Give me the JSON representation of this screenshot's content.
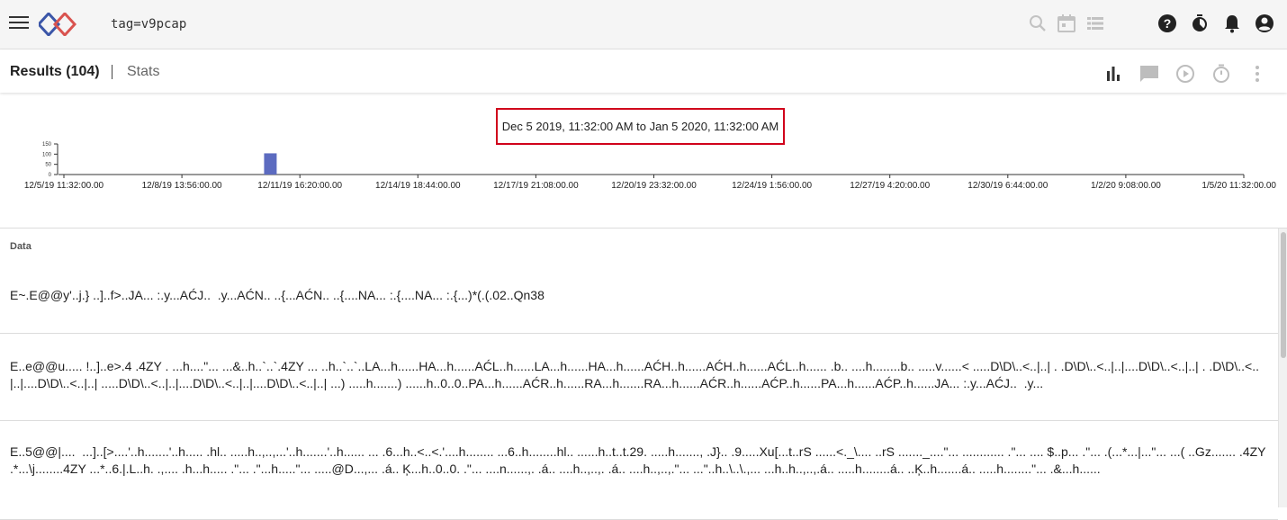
{
  "topbar": {
    "query": "tag=v9pcap",
    "icons": [
      "menu-icon",
      "gravwell-logo",
      "search-icon",
      "calendar-icon",
      "list-icon",
      "help-icon",
      "timer-icon",
      "notifications-icon",
      "account-icon"
    ]
  },
  "results_bar": {
    "results_label": "Results (104)",
    "stats_label": "Stats",
    "icons": [
      "bar-chart-icon",
      "comment-icon",
      "play-icon",
      "stopwatch-icon",
      "more-vert-icon"
    ]
  },
  "chart": {
    "time_range": "Dec 5 2019, 11:32:00 AM to Jan 5 2020, 11:32:00 AM",
    "colors": {
      "bar": "#5c6bc0",
      "range_border": "#d0021b"
    }
  },
  "chart_data": {
    "type": "bar",
    "x_ticks": [
      "12/5/19 11:32:00.00",
      "12/8/19 13:56:00.00",
      "12/11/19 16:20:00.00",
      "12/14/19 18:44:00.00",
      "12/17/19 21:08:00.00",
      "12/20/19 23:32:00.00",
      "12/24/19 1:56:00.00",
      "12/27/19 4:20:00.00",
      "12/30/19 6:44:00.00",
      "1/2/20 9:08:00.00",
      "1/5/20 11:32:00.00"
    ],
    "y_ticks": [
      "150",
      "100",
      "50",
      "0"
    ],
    "bars": [
      {
        "x_tick_index": 1.75,
        "value": 104
      }
    ],
    "ylim": [
      0,
      150
    ]
  },
  "data": {
    "header": "Data",
    "rows": [
      "E~.E@@y'..j.} ..]..f>..JA... :.y...AĆJ..  .y...AĆN.. ..{...AĆN.. ..{....NA... :.{....NA... :.{...)*(.(.02..Qn38",
      "E..e@@u..... !..]..e>.4 .4ZY . ...h....\"... ...&..h..`..`.4ZY ... ..h..`..`..LA...h......HA...h......AĆL..h......LA...h......HA...h......AĆH..h......AĆH..h......AĆL..h...... .b.. ....h........b.. .....v......< .....D\\D\\..<..|..| . .D\\D\\..<..|..|....D\\D\\..<..|..| . .D\\D\\..<..|..|....D\\D\\..<..|..| .....D\\D\\..<..|..|....D\\D\\..<..|..|....D\\D\\..<..|..| ...) .....h.......) ......h..0..0..PA...h......AĆR..h......RA...h.......RA...h......AĆR..h......AĆP..h......PA...h......AĆP..h......JA... :.y...AĆJ..  .y...",
      "E..5@@|....  ...]..[>....'..h.......'..h..... .hl.. .....h..,..,...'..h.......'..h...... ... .6...h..<..<.'....h........ ...6..h........hl.. ......h..t..t.29. .....h......., .J}.. .9.....Xu[...t..rS ......<._\\.... ..rS ......._....\"... ............ .\"... .... $..p... .\"... .(...*...|...\"... ...( ..Gz....... .4ZY .*...\\j........4ZY ...*..6.|.L..h. .,.... .h...h..... .\"... .\"...h.....\"... .....@D...,... .á.. Ķ...h..0..0. .\"... ....n......,. .á.. ....h..,..,. .á.. ....h..,..,.\"... ...\"..h..\\..\\.,... ...h..h..,..,.á.. .....h........á.. ..Ķ..h.......á.. .....h........\"... .&...h......"
    ]
  }
}
